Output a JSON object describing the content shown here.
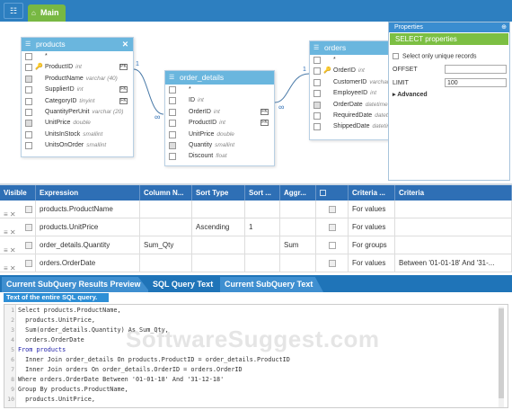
{
  "toolbar": {
    "main_tab": "Main"
  },
  "tables": [
    {
      "title": "products",
      "fields": [
        {
          "name": "*",
          "type": ""
        },
        {
          "name": "ProductID",
          "type": "int",
          "key": true,
          "checked": false
        },
        {
          "name": "ProductName",
          "type": "varchar (40)",
          "checked": true
        },
        {
          "name": "SupplierID",
          "type": "int"
        },
        {
          "name": "CategoryID",
          "type": "tinyint"
        },
        {
          "name": "QuantityPerUnit",
          "type": "varchar (20)"
        },
        {
          "name": "UnitPrice",
          "type": "double",
          "checked": true
        },
        {
          "name": "UnitsInStock",
          "type": "smallint"
        },
        {
          "name": "UnitsOnOrder",
          "type": "smallint"
        }
      ]
    },
    {
      "title": "order_details",
      "fields": [
        {
          "name": "*",
          "type": ""
        },
        {
          "name": "ID",
          "type": "int"
        },
        {
          "name": "OrderID",
          "type": "int"
        },
        {
          "name": "ProductID",
          "type": "int"
        },
        {
          "name": "UnitPrice",
          "type": "double"
        },
        {
          "name": "Quantity",
          "type": "smallint",
          "checked": true
        },
        {
          "name": "Discount",
          "type": "float"
        }
      ]
    },
    {
      "title": "orders",
      "fields": [
        {
          "name": "*",
          "type": ""
        },
        {
          "name": "OrderID",
          "type": "int",
          "key": true
        },
        {
          "name": "CustomerID",
          "type": "varchar"
        },
        {
          "name": "EmployeeID",
          "type": "int"
        },
        {
          "name": "OrderDate",
          "type": "datetime",
          "checked": true
        },
        {
          "name": "RequiredDate",
          "type": "datetime"
        },
        {
          "name": "ShippedDate",
          "type": "datetime"
        }
      ]
    }
  ],
  "relations": {
    "one": "1",
    "many": "∞"
  },
  "properties": {
    "title": "Properties",
    "select_title": "SELECT properties",
    "unique_label": "Select only unique records",
    "offset_label": "OFFSET",
    "offset_value": "",
    "limit_label": "LIMIT",
    "limit_value": "100",
    "advanced_label": "Advanced"
  },
  "grid": {
    "headers": [
      "Visible",
      "Expression",
      "Column N...",
      "Sort Type",
      "Sort ...",
      "Aggr...",
      "",
      "Criteria ...",
      "Criteria"
    ],
    "rows": [
      {
        "expression": "products.ProductName",
        "column": "",
        "sort_type": "",
        "sort_order": "",
        "aggr": "",
        "criteria_for": "For values",
        "criteria": ""
      },
      {
        "expression": "products.UnitPrice",
        "column": "",
        "sort_type": "Ascending",
        "sort_order": "1",
        "aggr": "",
        "criteria_for": "For values",
        "criteria": ""
      },
      {
        "expression": "order_details.Quantity",
        "column": "Sum_Qty",
        "sort_type": "",
        "sort_order": "",
        "aggr": "Sum",
        "criteria_for": "For groups",
        "criteria": ""
      },
      {
        "expression": "orders.OrderDate",
        "column": "",
        "sort_type": "",
        "sort_order": "",
        "aggr": "",
        "criteria_for": "For values",
        "criteria": "Between '01-01-18' And '31-..."
      }
    ]
  },
  "tabs": [
    "Current SubQuery Results Preview",
    "SQL Query Text",
    "Current SubQuery Text"
  ],
  "sql": {
    "header": "Text of the entire SQL query.",
    "lines": [
      "Select products.ProductName,",
      "  products.UnitPrice,",
      "  Sum(order_details.Quantity) As Sum_Qty,",
      "  orders.OrderDate",
      "From products",
      "  Inner Join order_details On products.ProductID = order_details.ProductID",
      "  Inner Join orders On order_details.OrderID = orders.OrderID",
      "Where orders.OrderDate Between '01-01-18' And '31-12-18'",
      "Group By products.ProductName,",
      "  products.UnitPrice,"
    ]
  },
  "watermark": "SoftwareSuggest.com"
}
